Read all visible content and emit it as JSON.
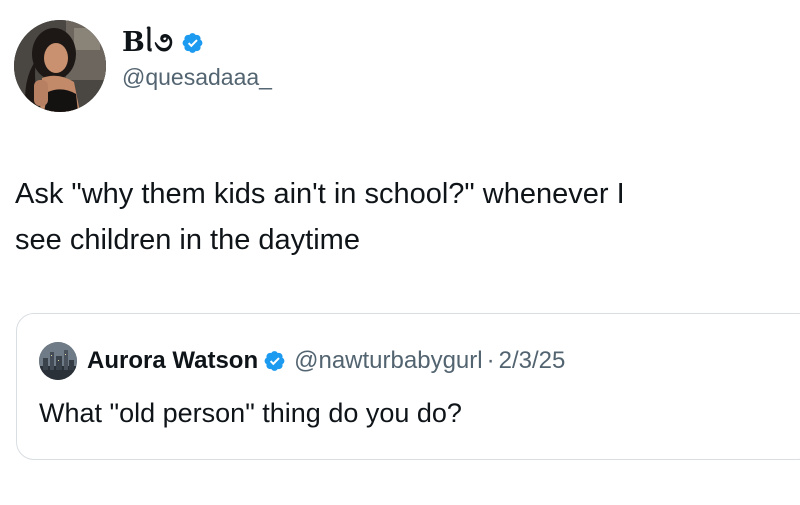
{
  "author": {
    "display_name": "Bᥣ૭",
    "handle": "@quesadaaa_",
    "avatar_icon": "profile-photo",
    "verified_icon": "verified-badge-icon",
    "verified_color": "#1d9bf0"
  },
  "tweet": {
    "line1": "Ask \"why them kids ain't in school?\" whenever I",
    "line2": "see children in the daytime"
  },
  "quoted_tweet": {
    "display_name": "Aurora Watson",
    "handle": "@nawturbabygurl",
    "separator": "·",
    "date": "2/3/25",
    "text": "What \"old person\" thing do you do?",
    "avatar_icon": "city-skyline-avatar",
    "verified_icon": "verified-badge-icon"
  },
  "colors": {
    "text_primary": "#0f1419",
    "text_secondary": "#536471",
    "border": "#d9dee2",
    "background": "#ffffff"
  }
}
